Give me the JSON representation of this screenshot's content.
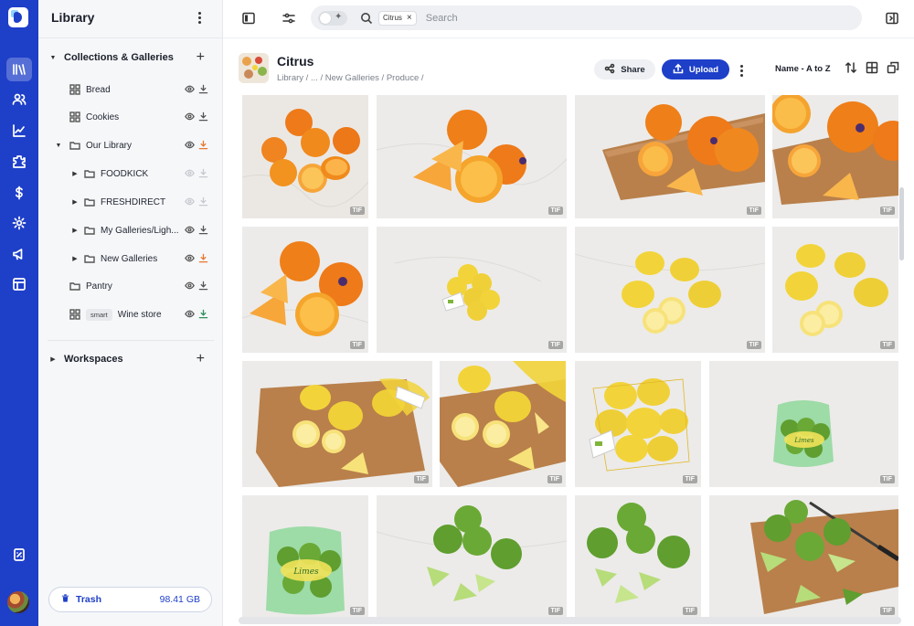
{
  "sidebar": {
    "title": "Library",
    "collections_title": "Collections & Galleries",
    "items": [
      {
        "label": "Bread"
      },
      {
        "label": "Cookies"
      },
      {
        "label": "Our Library"
      },
      {
        "label": "FOODKICK"
      },
      {
        "label": "FRESHDIRECT"
      },
      {
        "label": "My Galleries/Ligh..."
      },
      {
        "label": "New Galleries"
      },
      {
        "label": "Pantry"
      },
      {
        "label": "Wine store",
        "badge": "smart"
      }
    ],
    "workspaces_title": "Workspaces",
    "trash": {
      "label": "Trash",
      "size": "98.41 GB"
    }
  },
  "search": {
    "chip": "Citrus",
    "placeholder": "Search"
  },
  "page": {
    "title": "Citrus",
    "breadcrumb": "Library / ... / New Galleries / Produce /",
    "share_label": "Share",
    "upload_label": "Upload",
    "sort_label": "Name - A to Z"
  },
  "tiles": [
    {
      "type": "TIF",
      "subject": "oranges"
    },
    {
      "type": "TIF",
      "subject": "oranges"
    },
    {
      "type": "TIF",
      "subject": "oranges-board"
    },
    {
      "type": "TIF",
      "subject": "oranges-board"
    },
    {
      "type": "TIF",
      "subject": "oranges"
    },
    {
      "type": "TIF",
      "subject": "lemon-bag"
    },
    {
      "type": "TIF",
      "subject": "lemons"
    },
    {
      "type": "TIF",
      "subject": "lemons"
    },
    {
      "type": "TIF",
      "subject": "lemons-board"
    },
    {
      "type": "TIF",
      "subject": "lemons-board"
    },
    {
      "type": "TIF",
      "subject": "lemon-bag"
    },
    {
      "type": "TIF",
      "subject": "lime-bag"
    },
    {
      "type": "TIF",
      "subject": "lime-bag"
    },
    {
      "type": "TIF",
      "subject": "limes"
    },
    {
      "type": "TIF",
      "subject": "limes"
    },
    {
      "type": "TIF",
      "subject": "limes-board"
    }
  ],
  "colors": {
    "accent": "#1e3fc8",
    "orange": "#f08a1c",
    "lemon": "#f2d43a",
    "lime": "#7fb43a"
  }
}
